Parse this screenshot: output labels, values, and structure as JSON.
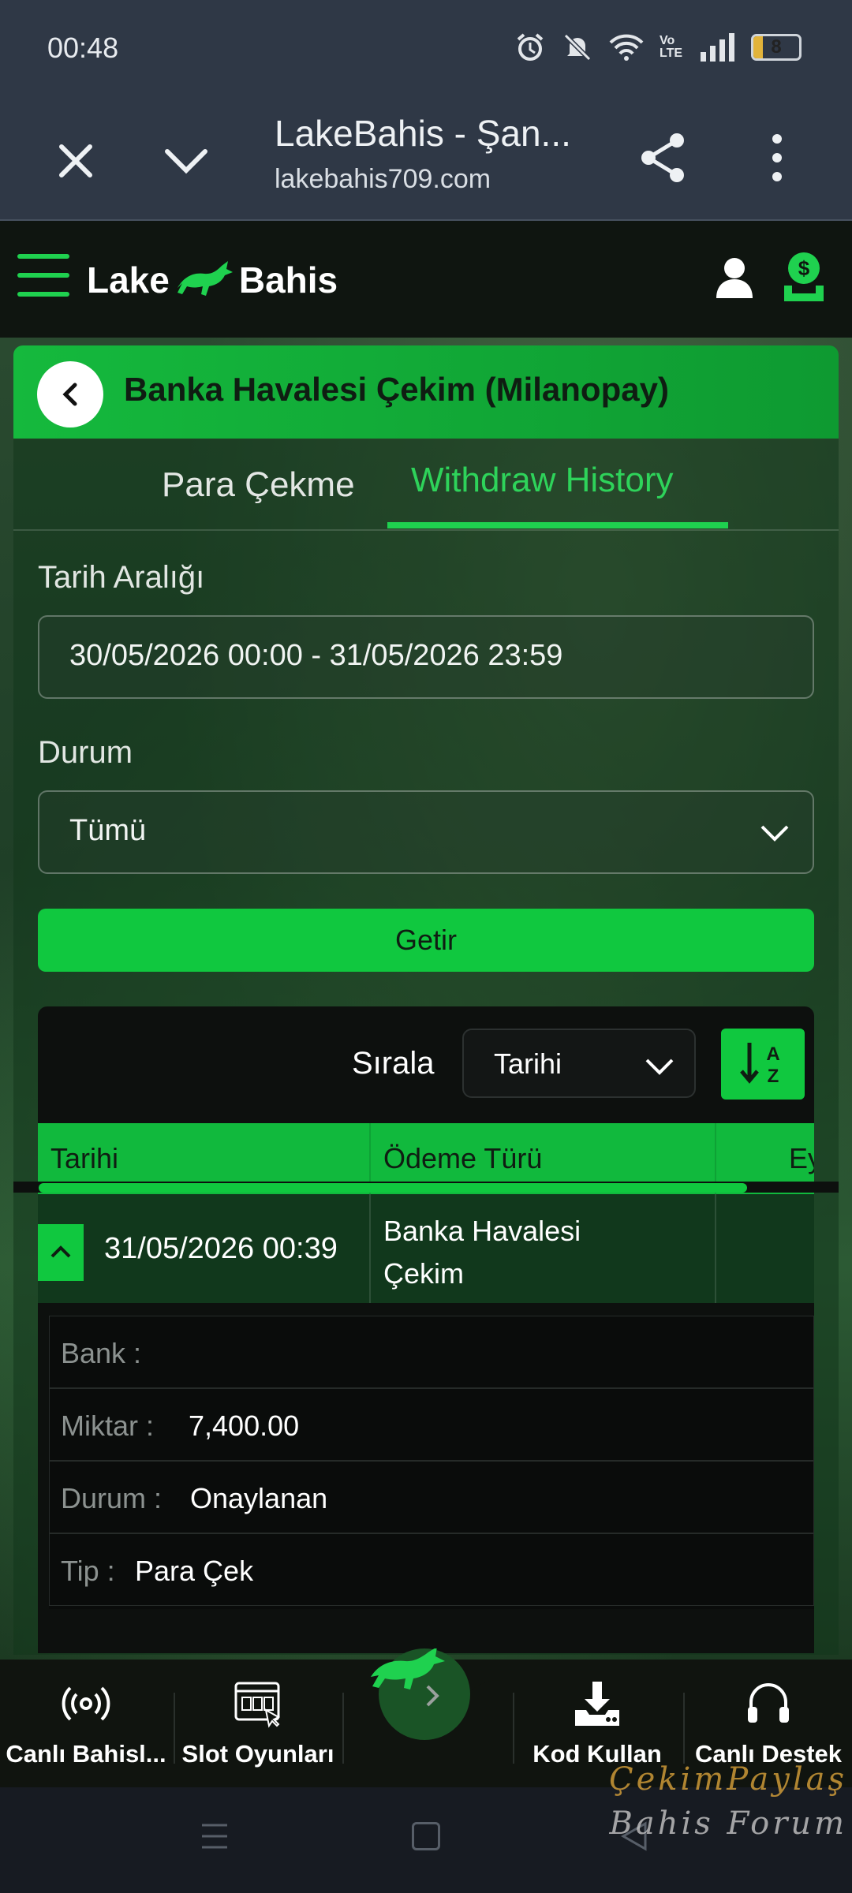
{
  "status_bar": {
    "time": "00:48",
    "network_label": "Vo LTE",
    "battery_level": "8",
    "battery_fraction": 0.2
  },
  "browser": {
    "title": "LakeBahis - Şan...",
    "url": "lakebahis709.com"
  },
  "site": {
    "logo_left": "Lake",
    "logo_right": "Bahis",
    "accent_color": "#10c83f"
  },
  "panel": {
    "title": "Banka Havalesi Çekim (Milanopay)",
    "tabs": [
      {
        "label": "Para Çekme",
        "active": false
      },
      {
        "label": "Withdraw History",
        "active": true
      }
    ],
    "date_range_label": "Tarih Aralığı",
    "date_range_value": "30/05/2026 00:00 - 31/05/2026 23:59",
    "status_label": "Durum",
    "status_value": "Tümü",
    "submit_label": "Getir"
  },
  "results": {
    "sort_label": "Sırala",
    "sort_value": "Tarihi",
    "columns": [
      "Tarihi",
      "Ödeme Türü",
      "Ey"
    ],
    "rows": [
      {
        "date": "31/05/2026 00:39",
        "payment_type": "Banka Havalesi Çekim",
        "details": [
          {
            "key": "Bank :",
            "value": ""
          },
          {
            "key": "Miktar :",
            "value": "7,400.00"
          },
          {
            "key": "Durum :",
            "value": "Onaylanan"
          },
          {
            "key": "Tip :",
            "value": "Para Çek"
          }
        ]
      }
    ]
  },
  "bottom_nav": [
    {
      "label": "Canlı Bahisl...",
      "icon": "live-broadcast-icon"
    },
    {
      "label": "Slot Oyunları",
      "icon": "slot-machine-icon"
    },
    {
      "label": "Kod Kullan",
      "icon": "download-icon"
    },
    {
      "label": "Canlı Destek",
      "icon": "headset-icon"
    }
  ],
  "watermark": {
    "line1": "ÇekimPaylaş",
    "line2": "Bahis Forum"
  }
}
